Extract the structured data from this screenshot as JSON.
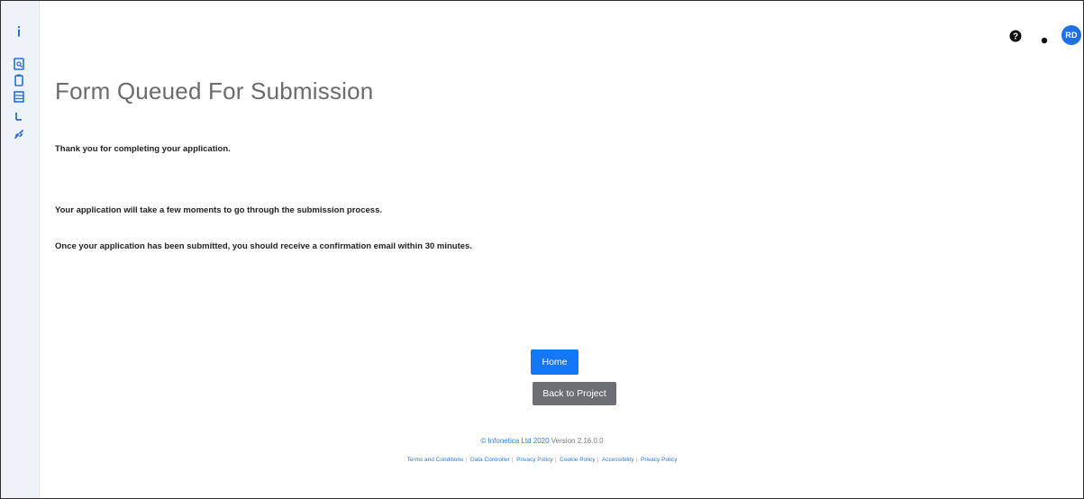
{
  "header": {
    "avatar_initials": "RD",
    "help_icon": "help-circle-icon",
    "dot_icon": "dot-icon"
  },
  "sidebar": {
    "items": [
      {
        "icon": "info-icon"
      },
      {
        "icon": "document-search-icon"
      },
      {
        "icon": "clipboard-icon"
      },
      {
        "icon": "building-icon"
      },
      {
        "icon": "chart-icon"
      },
      {
        "icon": "link-icon"
      }
    ]
  },
  "main": {
    "title": "Form Queued For Submission",
    "thank_you": "Thank you for completing your application.",
    "processing": "Your application will take a few moments to go through the submission process.",
    "confirmation": "Once your application has been submitted, you should receive a confirmation email within 30 minutes."
  },
  "buttons": {
    "home": "Home",
    "back": "Back to Project"
  },
  "footer": {
    "copyright": "© Infonetica Ltd 2020",
    "version": "Version 2.16.0.0",
    "links": [
      "Terms and Conditions",
      "Data Controller",
      "Privacy Policy",
      "Cookie Policy",
      "Accessibility",
      "Privacy Policy"
    ]
  },
  "colors": {
    "primary": "#1477f8",
    "secondary": "#6b6f73",
    "link": "#2a7ae4",
    "sidebar_bg": "#eef2f9"
  }
}
